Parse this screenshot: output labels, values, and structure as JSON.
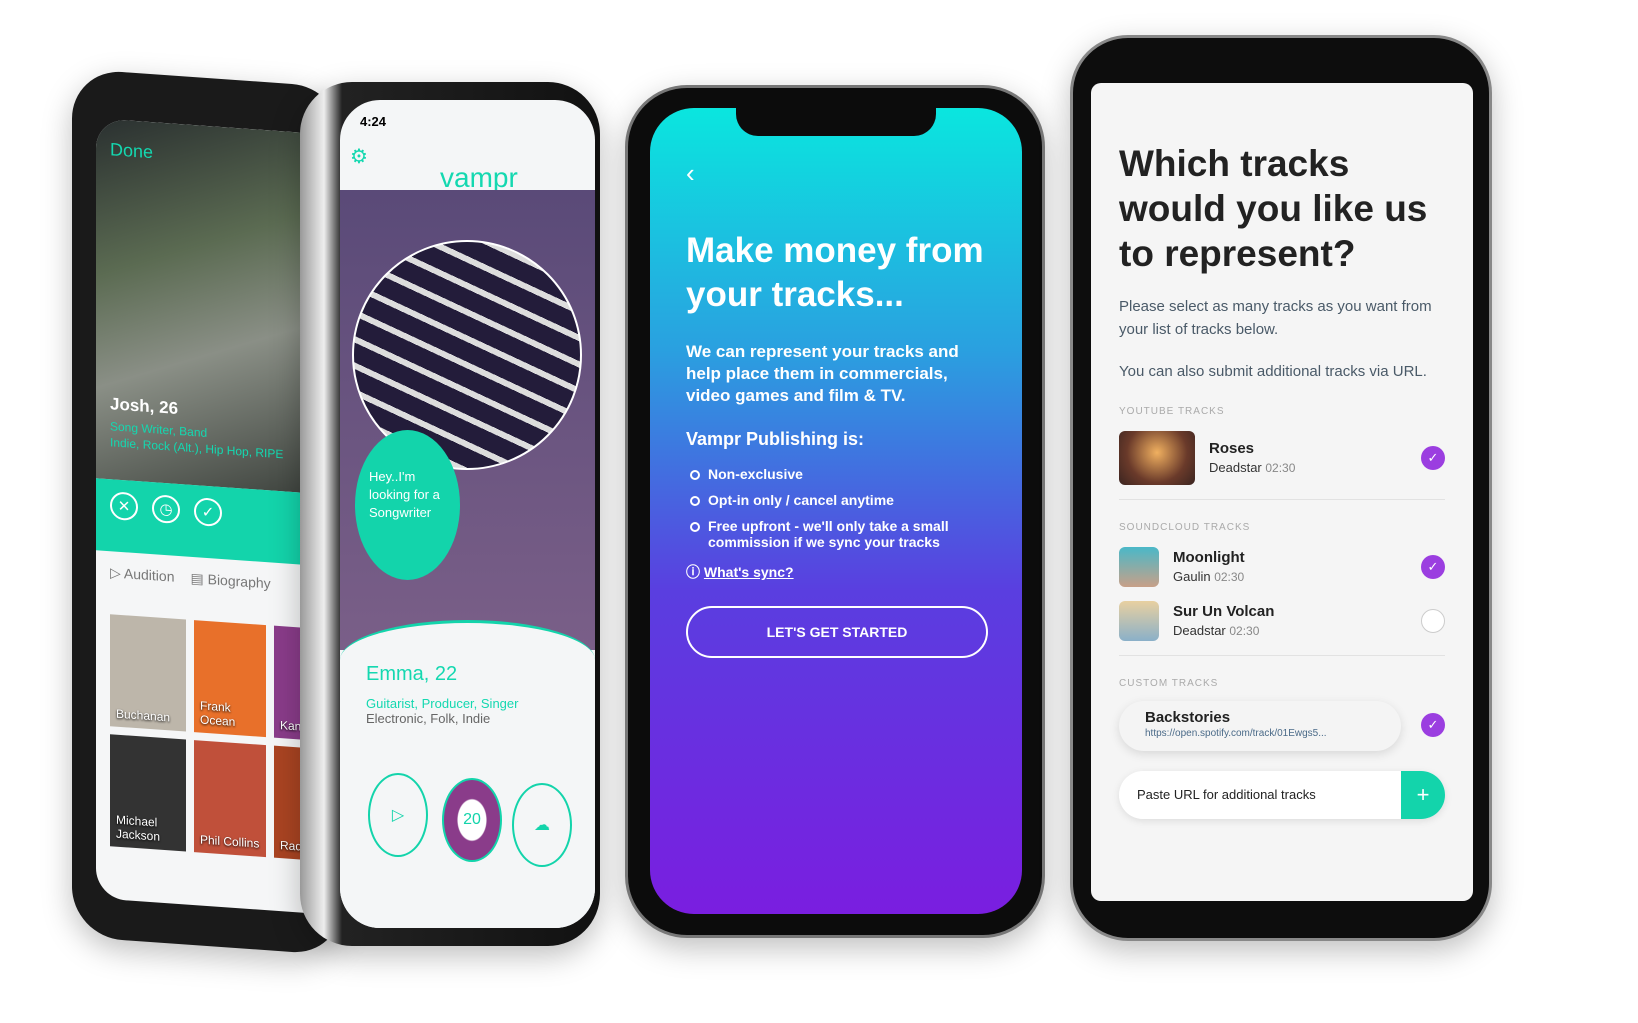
{
  "profile_phone": {
    "done": "Done",
    "name": "Josh, 26",
    "roles": "Song Writer, Band",
    "genres": "Indie, Rock (Alt.), Hip Hop, RIPE",
    "tabs": [
      "Audition",
      "Biography"
    ],
    "artists": [
      "Buchanan",
      "Frank Ocean",
      "Kany",
      "Michael Jackson",
      "Phil Collins",
      "Radio"
    ]
  },
  "match_phone": {
    "time": "4:24",
    "logo": "vampr",
    "bubble": "Hey..I'm looking for a Songwriter",
    "name": "Emma, 22",
    "roles": "Guitarist, Producer, Singer",
    "genres": "Electronic, Folk, Indie",
    "badge": "20"
  },
  "publishing_phone": {
    "title": "Make money from your tracks...",
    "description": "We can represent your tracks and help place them in commercials, video games and film & TV.",
    "subheading": "Vampr Publishing is:",
    "bullets": [
      "Non-exclusive",
      "Opt-in only / cancel anytime",
      "Free upfront - we'll only take a small commission if we sync your tracks"
    ],
    "sync_link": "What's sync?",
    "cta": "LET'S GET STARTED"
  },
  "tracks_phone": {
    "title": "Which tracks would you like us to represent?",
    "intro": "Please select as many tracks as you want from your list of tracks below.",
    "intro2": "You can also submit additional tracks via URL.",
    "sections": {
      "youtube": "YOUTUBE TRACKS",
      "soundcloud": "SOUNDCLOUD TRACKS",
      "custom": "CUSTOM TRACKS"
    },
    "youtube": [
      {
        "name": "Roses",
        "artist": "Deadstar",
        "duration": "02:30",
        "selected": true
      }
    ],
    "soundcloud": [
      {
        "name": "Moonlight",
        "artist": "Gaulin",
        "duration": "02:30",
        "selected": true
      },
      {
        "name": "Sur Un Volcan",
        "artist": "Deadstar",
        "duration": "02:30",
        "selected": false
      }
    ],
    "custom": [
      {
        "name": "Backstories",
        "url": "https://open.spotify.com/track/01Ewgs5...",
        "selected": true
      }
    ],
    "url_placeholder": "Paste URL for additional tracks",
    "add_icon": "plus-icon"
  },
  "colors": {
    "accent": "#13d4ab",
    "check": "#9b3ee0"
  }
}
